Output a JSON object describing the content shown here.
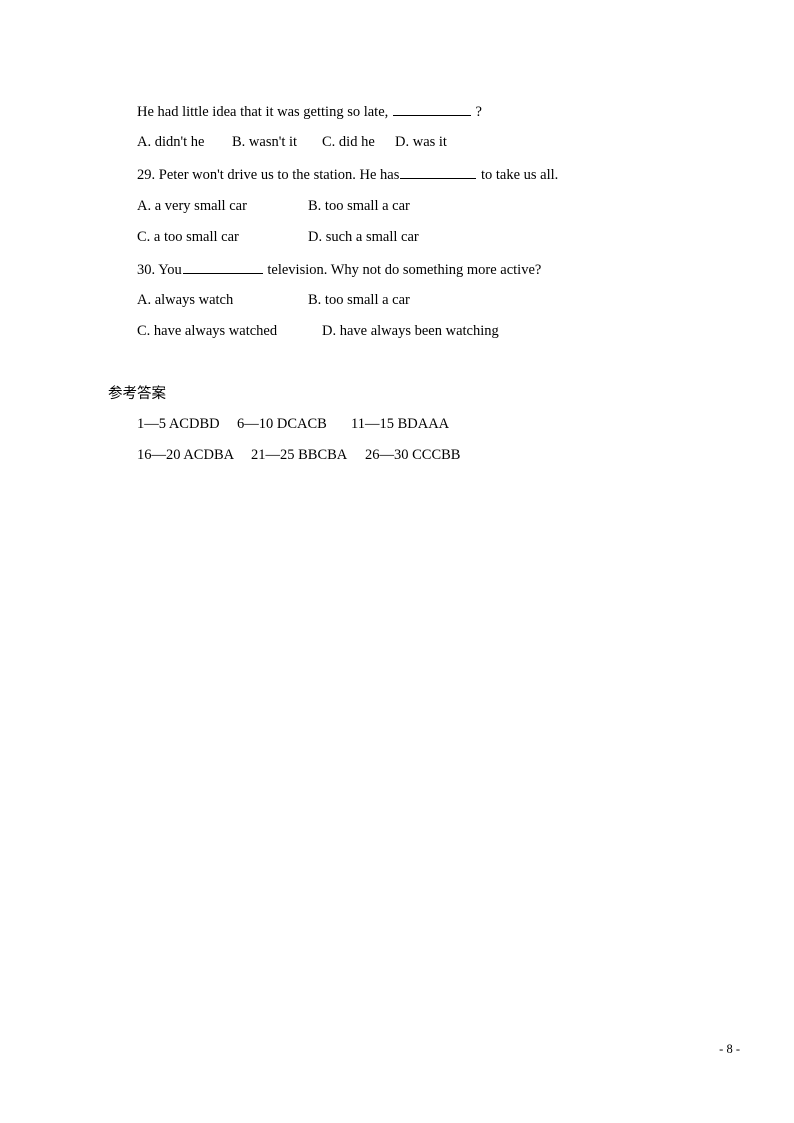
{
  "document": {
    "page_number_label": "- 8 -"
  },
  "questions": [
    {
      "stem_before": "He had little idea that it was getting so late, ",
      "blank": "__________",
      "stem_after": " ?",
      "options_rows": [
        [
          {
            "label": "A. didn't he"
          },
          {
            "label": "B. wasn't it"
          },
          {
            "label": "C. did he"
          },
          {
            "label": "D. was it"
          }
        ]
      ]
    },
    {
      "stem_before": "29. Peter won't drive us to the station. He has",
      "blank": "__________",
      "stem_after": " to take us all.",
      "options_rows": [
        [
          {
            "label": "A. a very small car"
          },
          {
            "label": "B. too small a car"
          }
        ],
        [
          {
            "label": "C. a too small car"
          },
          {
            "label": "D. such a small car"
          }
        ]
      ]
    },
    {
      "stem_before": "30. You",
      "blank": "__________",
      "stem_after": " television. Why not do something more active?",
      "options_rows": [
        [
          {
            "label": "A. always watch"
          },
          {
            "label": "B. too small a car"
          }
        ],
        [
          {
            "label": "C. have always watched"
          },
          {
            "label": "D. have always been watching"
          }
        ]
      ]
    }
  ],
  "answer_key": {
    "heading": "参考答案",
    "rows": [
      [
        {
          "range": "1—5",
          "answers": "ACDBD"
        },
        {
          "range": "6—10",
          "answers": "DCACB"
        },
        {
          "range": "11—15",
          "answers": "BDAAA"
        }
      ],
      [
        {
          "range": "16—20",
          "answers": "ACDBA"
        },
        {
          "range": "21—25",
          "answers": "BBCBA"
        },
        {
          "range": "26—30",
          "answers": "CCCBB"
        }
      ]
    ]
  }
}
